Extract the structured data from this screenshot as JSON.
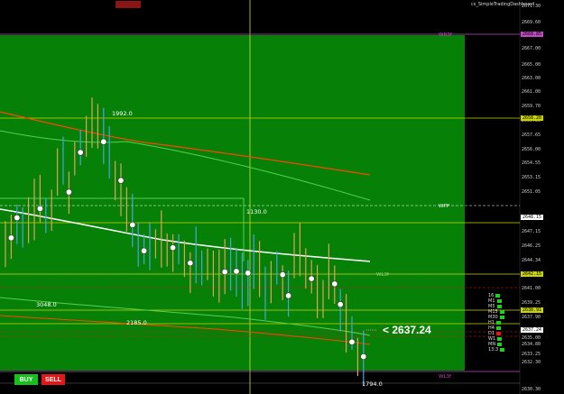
{
  "title": "cs_SimpleTradingDashboard",
  "top_tag": "",
  "price_axis": {
    "labels": [
      "2671.30",
      "2669.60",
      "2667.00",
      "2665.00",
      "2663.00",
      "2661.00",
      "2659.70",
      "2659.20",
      "2657.65",
      "2656.00",
      "2654.55",
      "2653.15",
      "2651.05",
      "2649.65",
      "2647.15",
      "2646.25",
      "2644.34",
      "2642.13",
      "2641.00",
      "2639.25",
      "2638.87",
      "2637.90",
      "2636.25",
      "2635.00",
      "2634.80",
      "2633.25",
      "2632.30",
      "2630.30"
    ],
    "highlights": [
      {
        "label": "2668.85",
        "color": "#c04ac0"
      },
      {
        "label": "2658.20",
        "color": "#c8d400"
      },
      {
        "label": "2648.15",
        "color": "#ffffff"
      },
      {
        "label": "2642.15",
        "color": "#c8d400"
      },
      {
        "label": "2638.91",
        "color": "#c8d400"
      },
      {
        "label": "2637.24",
        "color": "#ffffff"
      }
    ]
  },
  "levels": {
    "wr3_top": "WR3f",
    "wpp": "WPP",
    "wl3_bottom": "WL3f",
    "wl_mid": "WL3f"
  },
  "annotations": {
    "high": "1992.0",
    "mid1": "1130.0",
    "left": "3048.0",
    "mid2": "2185.0",
    "low": "1794.0"
  },
  "current_price": "< 2637.24",
  "level_panel": [
    {
      "label": "16",
      "color": "green"
    },
    {
      "label": "M1",
      "color": "green"
    },
    {
      "label": "M5",
      "color": "green"
    },
    {
      "label": "M15",
      "color": "green"
    },
    {
      "label": "M30",
      "color": "green"
    },
    {
      "label": "H1",
      "color": "green"
    },
    {
      "label": "H4",
      "color": "green"
    },
    {
      "label": "D1",
      "color": "red"
    },
    {
      "label": "W1",
      "color": "green"
    },
    {
      "label": "MN",
      "color": "green"
    },
    {
      "label": "13:3",
      "color": "green"
    }
  ],
  "buttons": {
    "buy": "BUY",
    "sell": "SELL"
  },
  "colors": {
    "background": "#000000",
    "zone": "#0a8a0a",
    "wr_line": "#c04ac0",
    "yellow_line": "#c8d400",
    "red_ma": "#ff4500",
    "white_ma": "#ffffff",
    "green_ma": "#53d053"
  }
}
